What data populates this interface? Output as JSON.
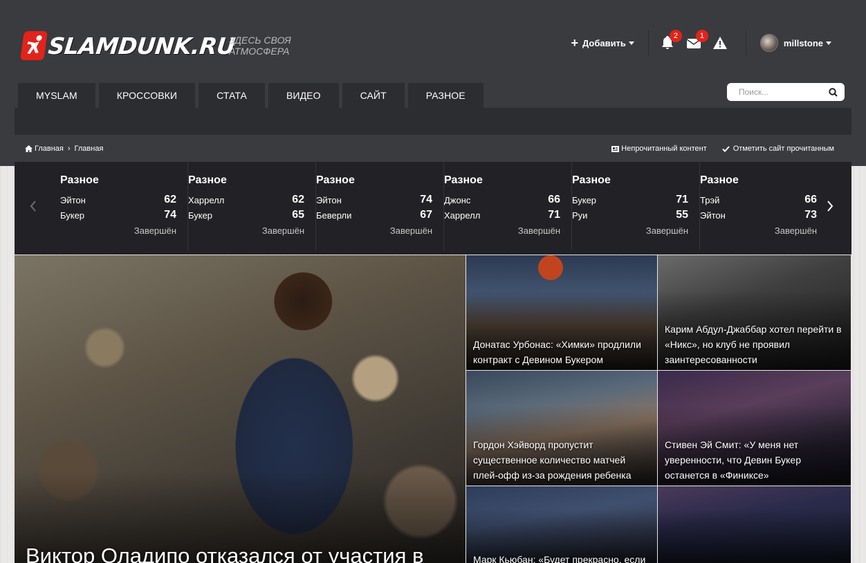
{
  "header": {
    "logo_text": "SLAMDUNK.RU",
    "tagline": "ЗДЕСЬ СВОЯ АТМОСФЕРА",
    "add_label": "Добавить",
    "notifications_count": "2",
    "messages_count": "1",
    "username": "millstone"
  },
  "nav": {
    "items": [
      {
        "label": "MYSLAM"
      },
      {
        "label": "КРОССОВКИ"
      },
      {
        "label": "СТАТА"
      },
      {
        "label": "ВИДЕО"
      },
      {
        "label": "САЙТ"
      },
      {
        "label": "РАЗНОЕ"
      }
    ]
  },
  "search": {
    "placeholder": "Поиск..."
  },
  "breadcrumb": {
    "home": "Главная",
    "current": "Главная",
    "unread": "Непрочитанный контент",
    "mark_read": "Отметить сайт прочитанным"
  },
  "scores": [
    {
      "label": "Разное",
      "team1": "Эйтон",
      "score1": "62",
      "team2": "Букер",
      "score2": "74",
      "status": "Завершён"
    },
    {
      "label": "Разное",
      "team1": "Харрелл",
      "score1": "62",
      "team2": "Букер",
      "score2": "65",
      "status": "Завершён"
    },
    {
      "label": "Разное",
      "team1": "Эйтон",
      "score1": "74",
      "team2": "Беверли",
      "score2": "67",
      "status": "Завершён"
    },
    {
      "label": "Разное",
      "team1": "Джонс",
      "score1": "66",
      "team2": "Харрелл",
      "score2": "71",
      "status": "Завершён"
    },
    {
      "label": "Разное",
      "team1": "Букер",
      "score1": "71",
      "team2": "Руи",
      "score2": "55",
      "status": "Завершён"
    },
    {
      "label": "Разное",
      "team1": "Трэй",
      "score1": "66",
      "team2": "Эйтон",
      "score2": "73",
      "status": "Завершён"
    }
  ],
  "hero": {
    "title": "Виктор Оладипо отказался от участия в"
  },
  "tiles": [
    {
      "title": "Донатас Урбонас: «Химки» продлили контракт с Девином Букером"
    },
    {
      "title": "Карим Абдул-Джаббар хотел перейти в «Никс», но клуб не проявил заинтересованности"
    },
    {
      "title": "Гордон Хэйворд пропустит существенное количество матчей плей-офф из-за рождения ребенка"
    },
    {
      "title": "Стивен Эй Смит: «У меня нет уверенности, что Девин Букер останется в «Финиксе»"
    },
    {
      "title": "Марк Кьюбан: «Будет прекрасно, если"
    },
    {
      "title": ""
    }
  ],
  "colors": {
    "accent": "#e2231a",
    "header_bg": "#3a3b3f",
    "nav_bg": "#2c2d31",
    "scores_bg": "#222226"
  }
}
